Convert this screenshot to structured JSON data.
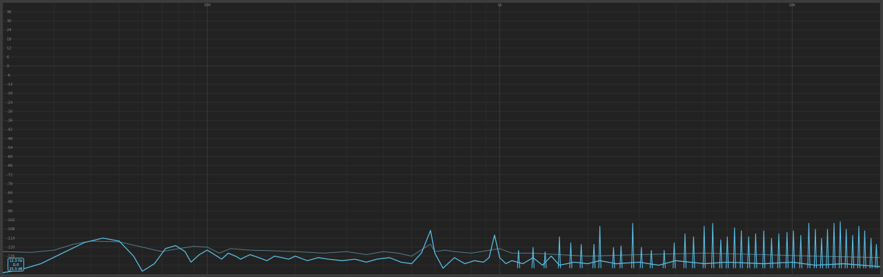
{
  "chart_data": {
    "type": "line",
    "title": "",
    "xlabel": "",
    "ylabel": "",
    "xscale": "log",
    "xlim": [
      20,
      20000
    ],
    "ylim": [
      -138,
      42
    ],
    "grid": true,
    "x_tick_labels": [
      {
        "value": 100,
        "label": "100"
      },
      {
        "value": 1000,
        "label": "1k"
      },
      {
        "value": 10000,
        "label": "10k"
      }
    ],
    "y_ticks": [
      36,
      30,
      24,
      18,
      12,
      6,
      0,
      -6,
      -12,
      -18,
      -24,
      -30,
      -36,
      -42,
      -48,
      -54,
      -60,
      -66,
      -72,
      -78,
      -84,
      -90,
      -96,
      -102,
      -108,
      -114,
      -120,
      -126,
      -132
    ],
    "series": [
      {
        "style": "peak-hold",
        "color": "#5d8ea2",
        "points": [
          [
            20,
            -123
          ],
          [
            25,
            -123.5
          ],
          [
            30,
            -122
          ],
          [
            35,
            -118
          ],
          [
            40,
            -116
          ],
          [
            50,
            -116.5
          ],
          [
            60,
            -120
          ],
          [
            70,
            -123
          ],
          [
            80,
            -121
          ],
          [
            90,
            -119.5
          ],
          [
            100,
            -120
          ],
          [
            110,
            -124
          ],
          [
            120,
            -121
          ],
          [
            140,
            -122
          ],
          [
            170,
            -122.5
          ],
          [
            200,
            -123
          ],
          [
            250,
            -124
          ],
          [
            300,
            -123
          ],
          [
            350,
            -125
          ],
          [
            400,
            -123
          ],
          [
            450,
            -124
          ],
          [
            500,
            -126
          ],
          [
            580,
            -118
          ],
          [
            600,
            -123
          ],
          [
            650,
            -122
          ],
          [
            700,
            -123
          ],
          [
            800,
            -124
          ],
          [
            1000,
            -121
          ],
          [
            1100,
            -124
          ],
          [
            1300,
            -124
          ],
          [
            1600,
            -125
          ],
          [
            2000,
            -126
          ],
          [
            3000,
            -125
          ],
          [
            5000,
            -124
          ],
          [
            8000,
            -125
          ],
          [
            12000,
            -126
          ],
          [
            20000,
            -127
          ]
        ]
      },
      {
        "style": "live",
        "color": "#58bfe8",
        "points": [
          [
            20,
            -137
          ],
          [
            23,
            -135
          ],
          [
            27,
            -131
          ],
          [
            32,
            -124
          ],
          [
            38,
            -117
          ],
          [
            44,
            -114
          ],
          [
            50,
            -116
          ],
          [
            56,
            -126
          ],
          [
            60,
            -136
          ],
          [
            66,
            -131
          ],
          [
            72,
            -121
          ],
          [
            78,
            -119
          ],
          [
            84,
            -123
          ],
          [
            88,
            -130
          ],
          [
            94,
            -125
          ],
          [
            100,
            -122
          ],
          [
            106,
            -125
          ],
          [
            112,
            -128
          ],
          [
            118,
            -124
          ],
          [
            125,
            -126
          ],
          [
            130,
            -128
          ],
          [
            140,
            -125
          ],
          [
            150,
            -127
          ],
          [
            160,
            -129
          ],
          [
            170,
            -126
          ],
          [
            180,
            -127
          ],
          [
            190,
            -128
          ],
          [
            200,
            -126
          ],
          [
            220,
            -129
          ],
          [
            240,
            -127
          ],
          [
            260,
            -128
          ],
          [
            290,
            -129
          ],
          [
            320,
            -128
          ],
          [
            350,
            -130
          ],
          [
            380,
            -128
          ],
          [
            420,
            -127
          ],
          [
            460,
            -130
          ],
          [
            500,
            -131
          ],
          [
            540,
            -124
          ],
          [
            580,
            -109
          ],
          [
            600,
            -124
          ],
          [
            640,
            -134
          ],
          [
            700,
            -127
          ],
          [
            760,
            -131
          ],
          [
            820,
            -129
          ],
          [
            880,
            -130
          ],
          [
            920,
            -127
          ],
          [
            960,
            -112
          ],
          [
            1000,
            -127
          ],
          [
            1050,
            -131
          ],
          [
            1100,
            -129
          ],
          [
            1200,
            -131
          ],
          [
            1300,
            -127
          ],
          [
            1400,
            -132
          ],
          [
            1500,
            -126
          ],
          [
            1600,
            -132
          ],
          [
            1800,
            -130
          ],
          [
            2000,
            -131
          ],
          [
            2200,
            -129
          ],
          [
            2500,
            -131
          ],
          [
            3000,
            -130
          ],
          [
            3500,
            -132
          ],
          [
            4000,
            -129
          ],
          [
            5000,
            -131
          ],
          [
            6000,
            -130
          ],
          [
            8000,
            -131
          ],
          [
            10000,
            -130
          ],
          [
            12000,
            -132
          ],
          [
            15000,
            -131
          ],
          [
            20000,
            -133
          ]
        ]
      },
      {
        "style": "harmonic-spikes",
        "color": "#58bfe8",
        "floor": -134,
        "peaks": [
          [
            1160,
            -122
          ],
          [
            1300,
            -120
          ],
          [
            1430,
            -123
          ],
          [
            1600,
            -113
          ],
          [
            1750,
            -117
          ],
          [
            1900,
            -118
          ],
          [
            2100,
            -118
          ],
          [
            2200,
            -106
          ],
          [
            2450,
            -120
          ],
          [
            2600,
            -119
          ],
          [
            2850,
            -104
          ],
          [
            3050,
            -120
          ],
          [
            3300,
            -122
          ],
          [
            3650,
            -122
          ],
          [
            3950,
            -117
          ],
          [
            4300,
            -111
          ],
          [
            4600,
            -113
          ],
          [
            5000,
            -106
          ],
          [
            5350,
            -104
          ],
          [
            5700,
            -115
          ],
          [
            6000,
            -113
          ],
          [
            6350,
            -107
          ],
          [
            6700,
            -109
          ],
          [
            7100,
            -113
          ],
          [
            7500,
            -111
          ],
          [
            8000,
            -109
          ],
          [
            8500,
            -114
          ],
          [
            9000,
            -111
          ],
          [
            9600,
            -110
          ],
          [
            10100,
            -109
          ],
          [
            10700,
            -112
          ],
          [
            11400,
            -104
          ],
          [
            12000,
            -108
          ],
          [
            12600,
            -114
          ],
          [
            13200,
            -108
          ],
          [
            13900,
            -104
          ],
          [
            14600,
            -103
          ],
          [
            15300,
            -108
          ],
          [
            16100,
            -112
          ],
          [
            16900,
            -106
          ],
          [
            17700,
            -109
          ],
          [
            18600,
            -114
          ],
          [
            19400,
            -118
          ]
        ]
      }
    ]
  },
  "readout": {
    "freq": "12.3 Hz",
    "note": "G-0",
    "level": "25.3 dB"
  }
}
